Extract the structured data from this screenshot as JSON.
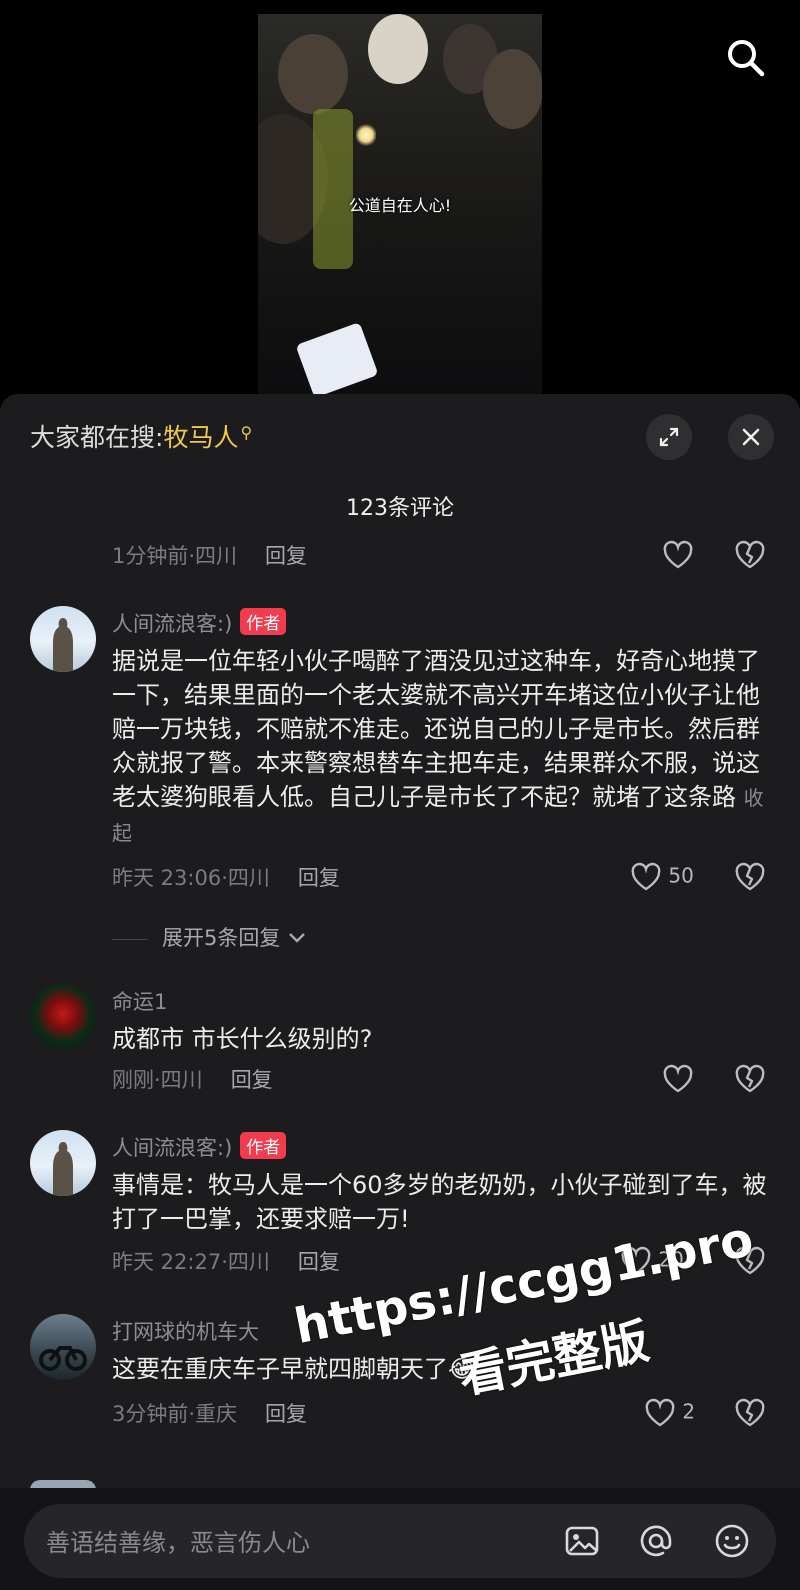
{
  "video": {
    "caption": "公道自在人心!"
  },
  "header": {
    "hot_label": "大家都在搜:",
    "hot_keyword": "牧马人"
  },
  "comment_count": "123条评论",
  "comments": [
    {
      "time_loc": "1分钟前·四川",
      "reply": "回复",
      "likes": ""
    },
    {
      "name": "人间流浪客:)",
      "tag": "作者",
      "text": "据说是一位年轻小伙子喝醉了酒没见过这种车，好奇心地摸了一下，结果里面的一个老太婆就不高兴开车堵这位小伙子让他赔一万块钱，不赔就不准走。还说自己的儿子是市长。然后群众就报了警。本来警察想替车主把车走，结果群众不服，说这老太婆狗眼看人低。自己儿子是市长了不起？就堵了这条路",
      "fold": "收起",
      "time_loc": "昨天 23:06·四川",
      "reply": "回复",
      "likes": "50"
    },
    {
      "name": "命运1",
      "text": "成都市 市长什么级别的?",
      "time_loc": "刚刚·四川",
      "reply": "回复",
      "likes": ""
    },
    {
      "name": "人间流浪客:)",
      "tag": "作者",
      "text": "事情是：牧马人是一个60多岁的老奶奶，小伙子碰到了车，被打了一巴掌，还要求赔一万!",
      "time_loc": "昨天 22:27·四川",
      "reply": "回复",
      "likes": "20"
    },
    {
      "name": "打网球的机车大",
      "text": "这要在重庆车子早就四脚朝天了",
      "emoji": "😂",
      "time_loc": "3分钟前·重庆",
      "reply": "回复",
      "likes": "2"
    }
  ],
  "expand_replies": "展开5条回复",
  "input": {
    "placeholder": "善语结善缘，恶言伤人心"
  },
  "watermark": {
    "line1": "https://ccgg1.pro",
    "line2": "看完整版"
  }
}
